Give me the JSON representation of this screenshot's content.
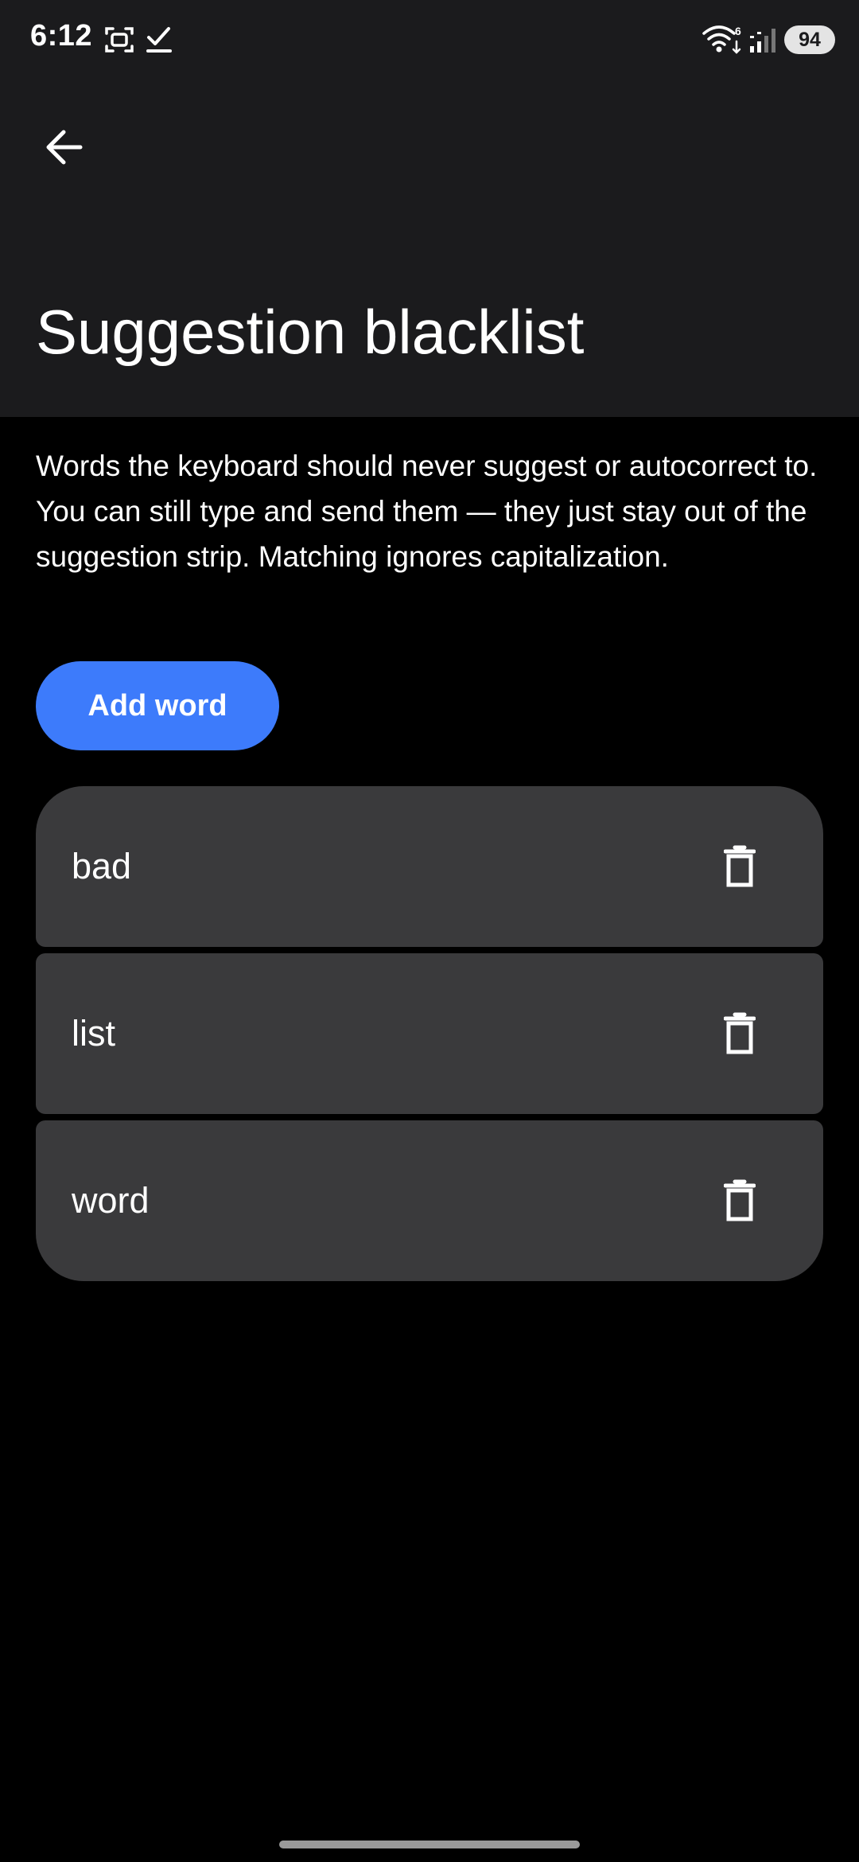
{
  "status_bar": {
    "time": "6:12",
    "battery": "94",
    "wifi_badge": "6",
    "left_icons": [
      "screenshot-icon",
      "check-icon"
    ],
    "right_icons": [
      "wifi-icon",
      "signal-icon",
      "battery-icon"
    ]
  },
  "header": {
    "back_icon": "arrow-left-icon",
    "title": "Suggestion blacklist"
  },
  "content": {
    "description": "Words the keyboard should never suggest or autocorrect to. You can still type and send them — they just stay out of the suggestion strip. Matching ignores capitalization.",
    "add_button_label": "Add word",
    "words": [
      {
        "word": "bad",
        "delete_icon": "trash-icon"
      },
      {
        "word": "list",
        "delete_icon": "trash-icon"
      },
      {
        "word": "word",
        "delete_icon": "trash-icon"
      }
    ]
  },
  "colors": {
    "app_bar_background": "#1b1b1d",
    "page_background": "#000000",
    "accent": "#3d7bfb",
    "list_item_background": "#3a3a3c",
    "text": "#ffffff"
  }
}
